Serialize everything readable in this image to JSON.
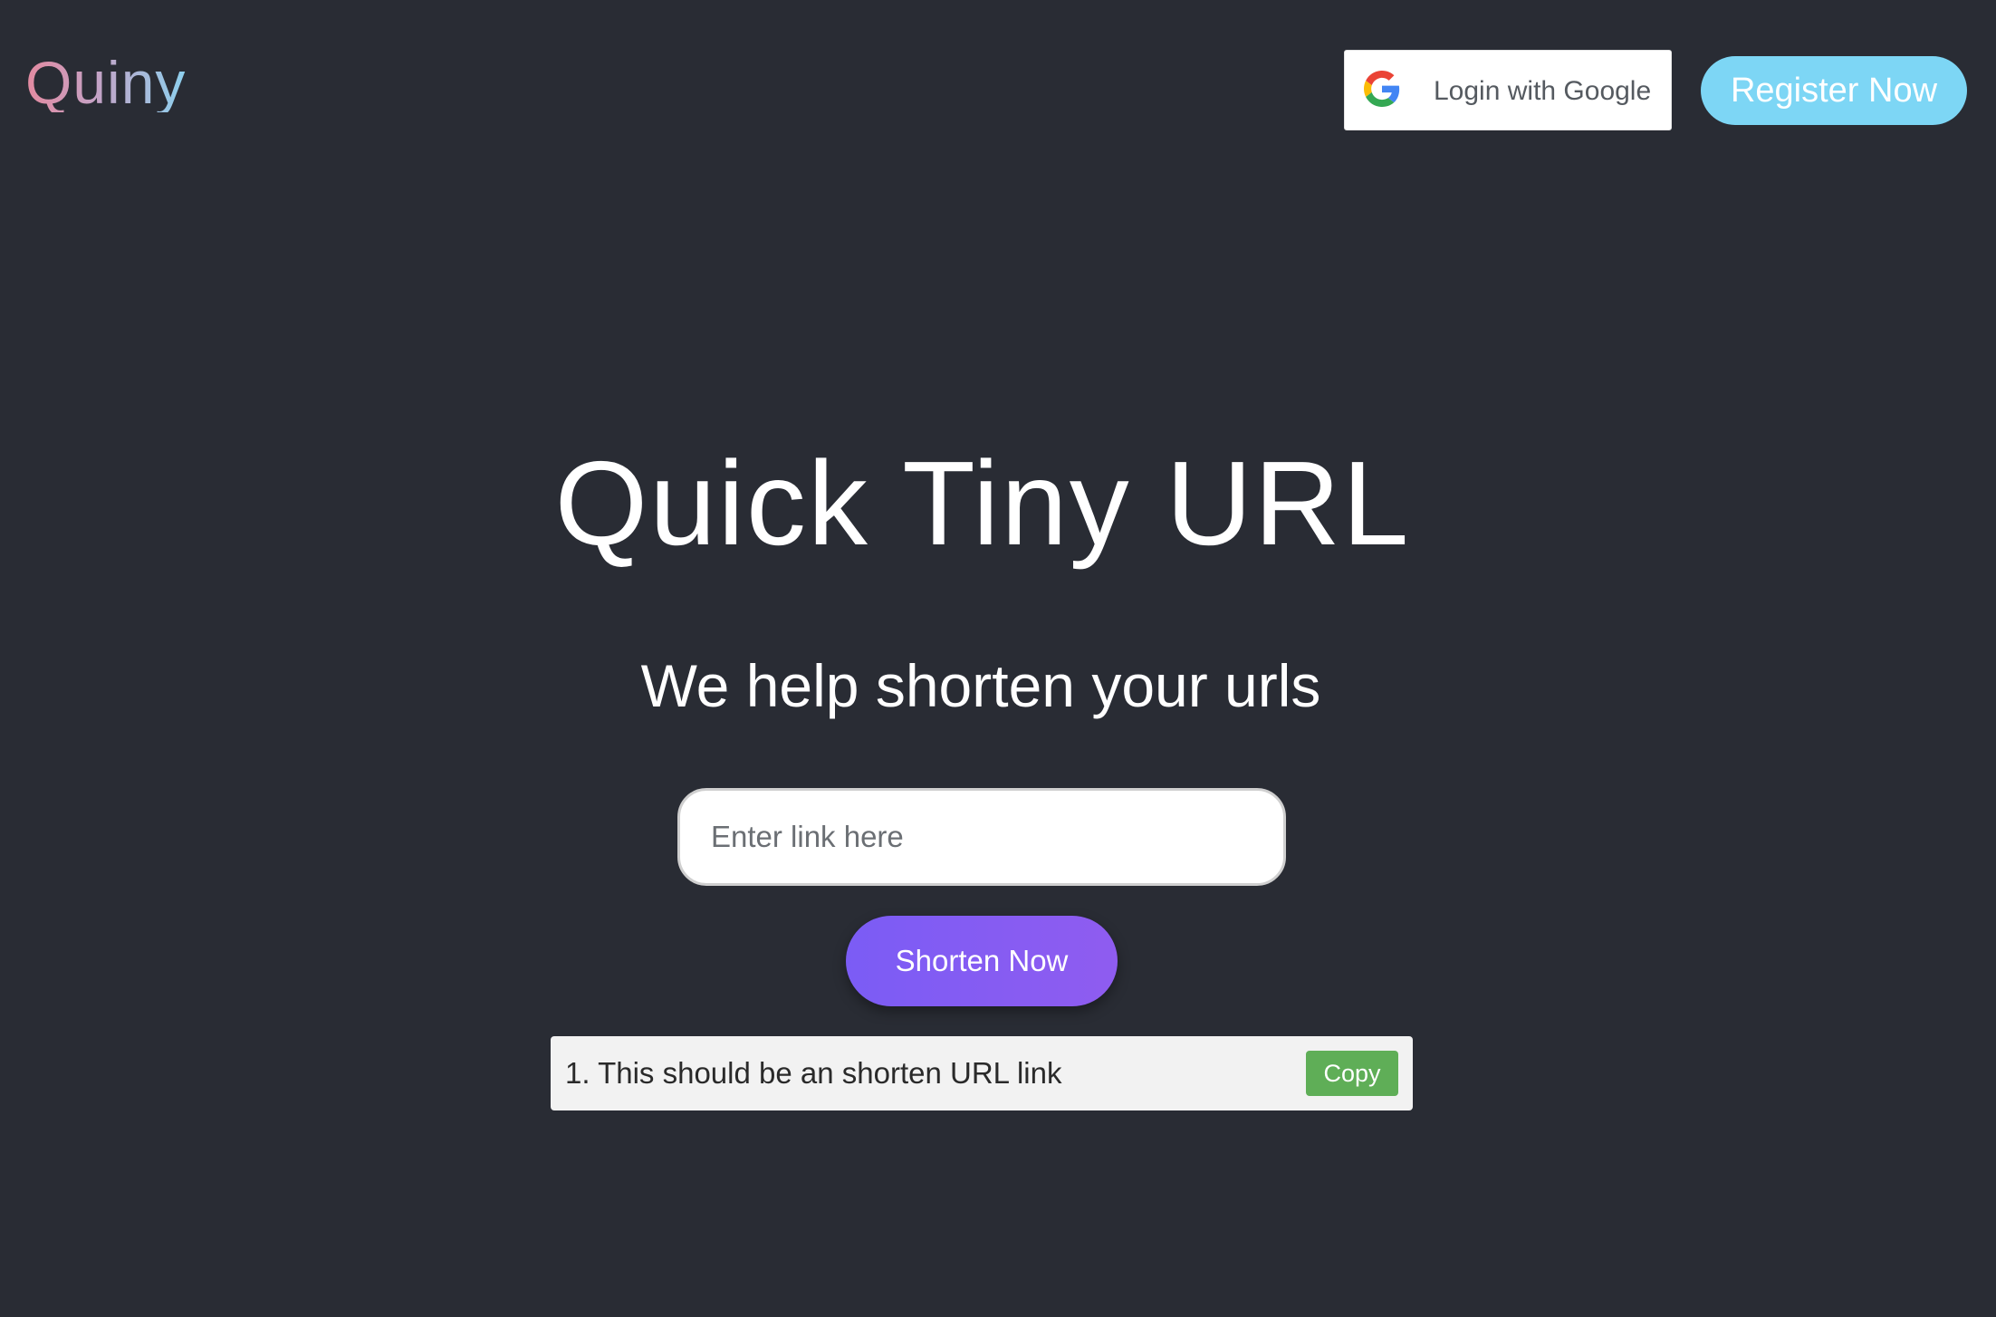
{
  "header": {
    "logo_text": "Quiny",
    "google_button": {
      "label": "Login with Google",
      "icon": "google-g-icon"
    },
    "register_button": {
      "label": "Register Now"
    }
  },
  "hero": {
    "title": "Quick Tiny URL",
    "subtitle": "We help shorten your urls"
  },
  "form": {
    "link_input": {
      "value": "",
      "placeholder": "Enter link here"
    },
    "shorten_button": {
      "label": "Shorten Now"
    }
  },
  "results": [
    {
      "text": "1. This should be an shorten URL link",
      "copy_label": "Copy"
    }
  ],
  "colors": {
    "background": "#292c34",
    "register_accent": "#7dd6f5",
    "shorten_accent": "#8060f4",
    "copy_accent": "#5fae57"
  }
}
